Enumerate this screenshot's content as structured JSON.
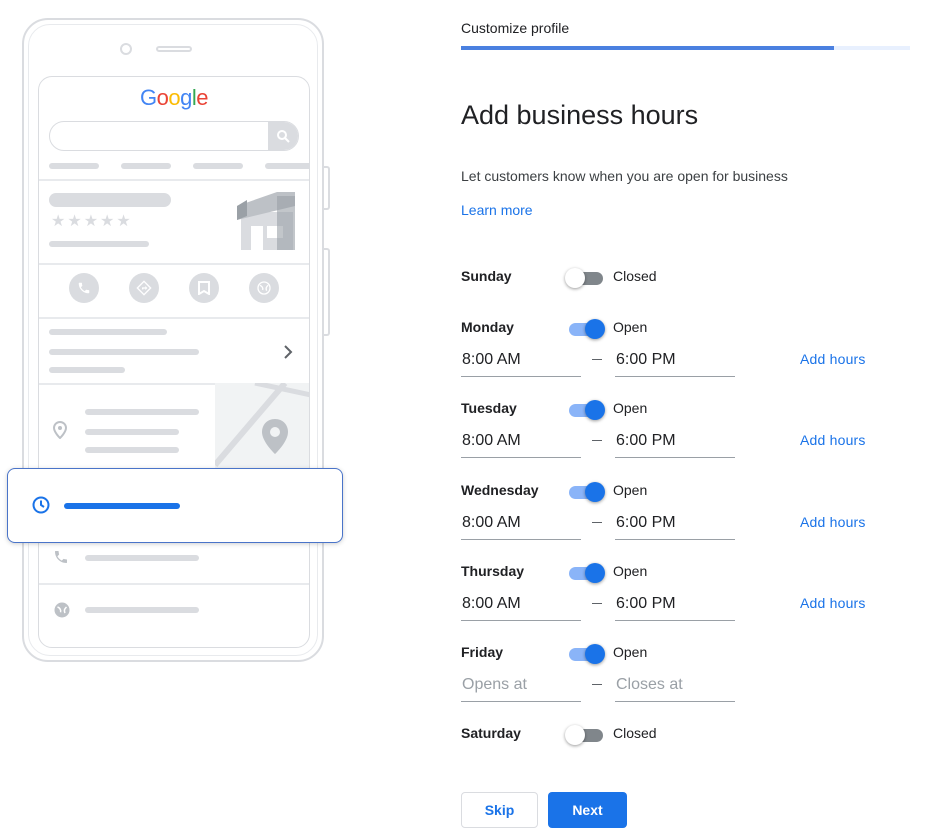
{
  "header": {
    "step_label": "Customize profile",
    "progress_fraction": 0.83
  },
  "main": {
    "title": "Add business hours",
    "subtitle": "Let customers know when you are open for business",
    "learn_more": "Learn more"
  },
  "illustration": {
    "logo_letters": [
      "G",
      "o",
      "o",
      "g",
      "l",
      "e"
    ],
    "logo_colors": [
      "#4285F4",
      "#EA4335",
      "#FBBC05",
      "#4285F4",
      "#34A853",
      "#EA4335"
    ],
    "stars": "★★★★★"
  },
  "days": [
    {
      "name": "Sunday",
      "open": false,
      "status": "Closed"
    },
    {
      "name": "Monday",
      "open": true,
      "status": "Open",
      "opens": "8:00 AM",
      "closes": "6:00 PM",
      "add_hours": "Add hours"
    },
    {
      "name": "Tuesday",
      "open": true,
      "status": "Open",
      "opens": "8:00 AM",
      "closes": "6:00 PM",
      "add_hours": "Add hours"
    },
    {
      "name": "Wednesday",
      "open": true,
      "status": "Open",
      "opens": "8:00 AM",
      "closes": "6:00 PM",
      "add_hours": "Add hours"
    },
    {
      "name": "Thursday",
      "open": true,
      "status": "Open",
      "opens": "8:00 AM",
      "closes": "6:00 PM",
      "add_hours": "Add hours"
    },
    {
      "name": "Friday",
      "open": true,
      "status": "Open",
      "opens_placeholder": "Opens at",
      "closes_placeholder": "Closes at"
    },
    {
      "name": "Saturday",
      "open": false,
      "status": "Closed"
    }
  ],
  "actions": {
    "skip_label": "Skip",
    "next_label": "Next"
  },
  "colors": {
    "accent": "#1a73e8",
    "toggle_track_on": "#8ab4f8",
    "toggle_track_off": "#80868b"
  }
}
